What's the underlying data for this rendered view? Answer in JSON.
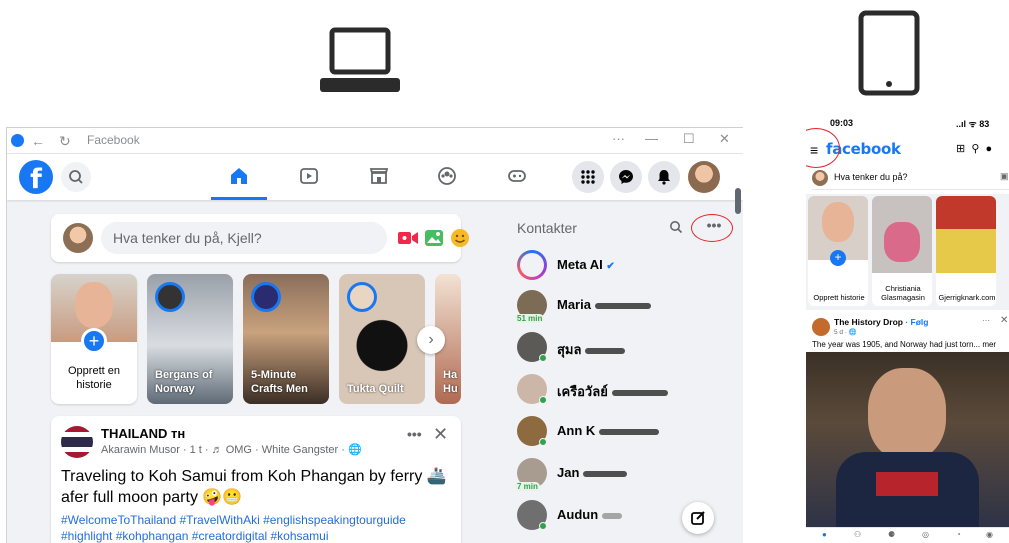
{
  "devices": {
    "laptop": "laptop-icon",
    "tablet": "tablet-icon"
  },
  "desktop": {
    "window": {
      "title": "Facebook",
      "controls": {
        "more": "···",
        "minimize": "—",
        "maximize": "☐",
        "close": "✕"
      }
    },
    "composer": {
      "placeholder": "Hva tenker du på, Kjell?"
    },
    "stories": [
      {
        "label": "Opprett en historie",
        "type": "create"
      },
      {
        "label": "Bergans of Norway"
      },
      {
        "label": "5-Minute Crafts Men"
      },
      {
        "label": "Tukta Quilt"
      },
      {
        "label": "Ha Hu"
      }
    ],
    "post": {
      "page": "THAILAND ᴛʜ",
      "meta": "Akarawin Musor · 1 t · ♬ OMG · White Gangster · 🌐",
      "text": "Traveling to Koh Samui from Koh Phangan by ferry 🚢 afer full moon party 🤪😬",
      "hashtags": "#WelcomeToThailand #TravelWithAki #englishspeakingtourguide #highlight #kohphangan #creatordigital #kohsamui"
    },
    "contacts": {
      "heading": "Kontakter",
      "items": [
        {
          "name": "Meta AI",
          "verified": "✔"
        },
        {
          "name": "Maria",
          "badge": "51 min"
        },
        {
          "name": "สุมล",
          "online": true
        },
        {
          "name": "เครือวัลย์",
          "online": true
        },
        {
          "name": "Ann K",
          "online": true
        },
        {
          "name": "Jan",
          "badge": "7 min"
        },
        {
          "name": "Audun",
          "online": true
        }
      ]
    },
    "colors": {
      "brand": "#1877f2",
      "annotation": "#e0242b",
      "online": "#31a24c"
    }
  },
  "tablet": {
    "status": {
      "time": "09:03",
      "signal": "..ıl ᯤ 83"
    },
    "logo": "facebook",
    "composer": "Hva tenker du på?",
    "stories": [
      {
        "label": "Opprett historie"
      },
      {
        "label": "Christiania Glasmagasin"
      },
      {
        "label": "Gjerrigknark.com"
      }
    ],
    "post": {
      "page": "The History Drop",
      "follow": "· Følg",
      "time": "5 d · 🌐",
      "text": "The year was 1905, and Norway had just torn... mer"
    }
  }
}
